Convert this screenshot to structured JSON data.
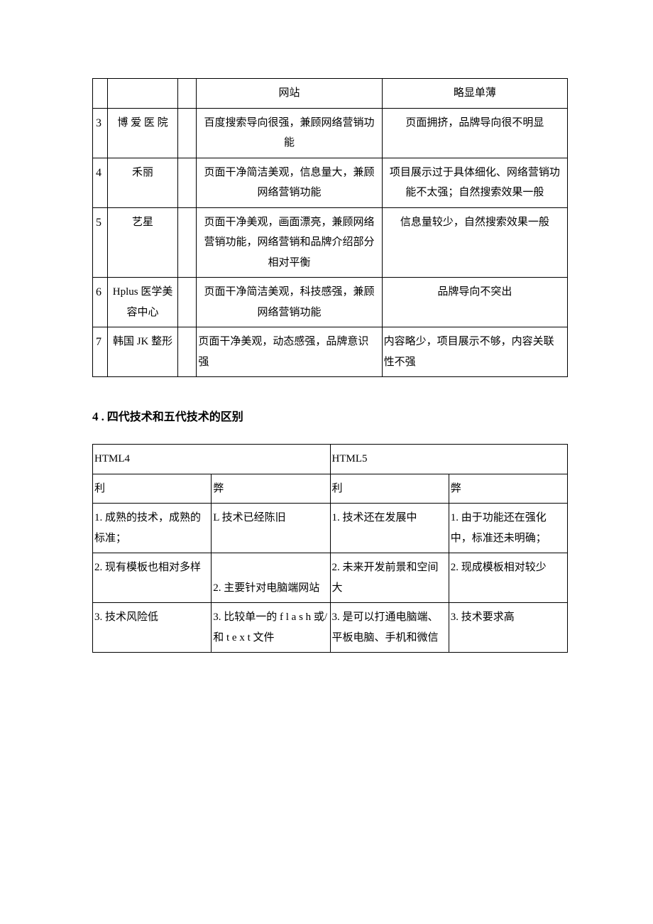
{
  "table1": {
    "row0": {
      "c3": "网站",
      "c4": "略显单薄"
    },
    "rows": [
      {
        "n": "3",
        "name": "博 爱 医 院",
        "pros": "百度搜索导向很强，兼顾网络营销功能",
        "cons": "页面拥挤，品牌导向很不明显"
      },
      {
        "n": "4",
        "name": "禾丽",
        "pros": "页面干净简洁美观，信息量大，兼顾网络营销功能",
        "cons": "项目展示过于具体细化、网络营销功能不太强；自然搜索效果一般"
      },
      {
        "n": "5",
        "name": "艺星",
        "pros": "页面干净美观，画面漂亮，兼顾网络营销功能，网络营销和品牌介绍部分相对平衡",
        "cons": "信息量较少，自然搜索效果一般"
      },
      {
        "n": "6",
        "name": "Hplus 医学美容中心",
        "pros": "页面干净简洁美观，科技感强，兼顾网络营销功能",
        "cons": "品牌导向不突出"
      },
      {
        "n": "7",
        "name": "韩国 JK 整形",
        "pros": "页面干净美观，动态感强，品牌意识强",
        "cons": "内容略少，项目展示不够，内容关联性不强"
      }
    ]
  },
  "heading": {
    "num": "4 ",
    "text": ". 四代技术和五代技术的区别"
  },
  "table2": {
    "h": {
      "a": "HTML4",
      "b": "HTML5"
    },
    "sub": {
      "a1": "利",
      "a2": "弊",
      "b1": "利",
      "b2": "弊"
    },
    "rows": [
      {
        "a1": "1. 成熟的技术，成熟的标准；",
        "a2": "L 技术已经陈旧",
        "b1": "1. 技术还在发展中",
        "b2": "1. 由于功能还在强化中，标准还未明确；"
      },
      {
        "a1": "2. 现有模板也相对多样",
        "a2": "2. 主要针对电脑端网站",
        "b1": "2. 未来开发前景和空间大",
        "b2": "2. 现成模板相对较少"
      },
      {
        "a1": "3. 技术风险低",
        "a2": "3. 比较单一的 f l a s h 或/ 和 t e x t 文件",
        "b1": "3. 是可以打通电脑端、平板电脑、手机和微信",
        "b2": "3. 技术要求高"
      }
    ]
  }
}
